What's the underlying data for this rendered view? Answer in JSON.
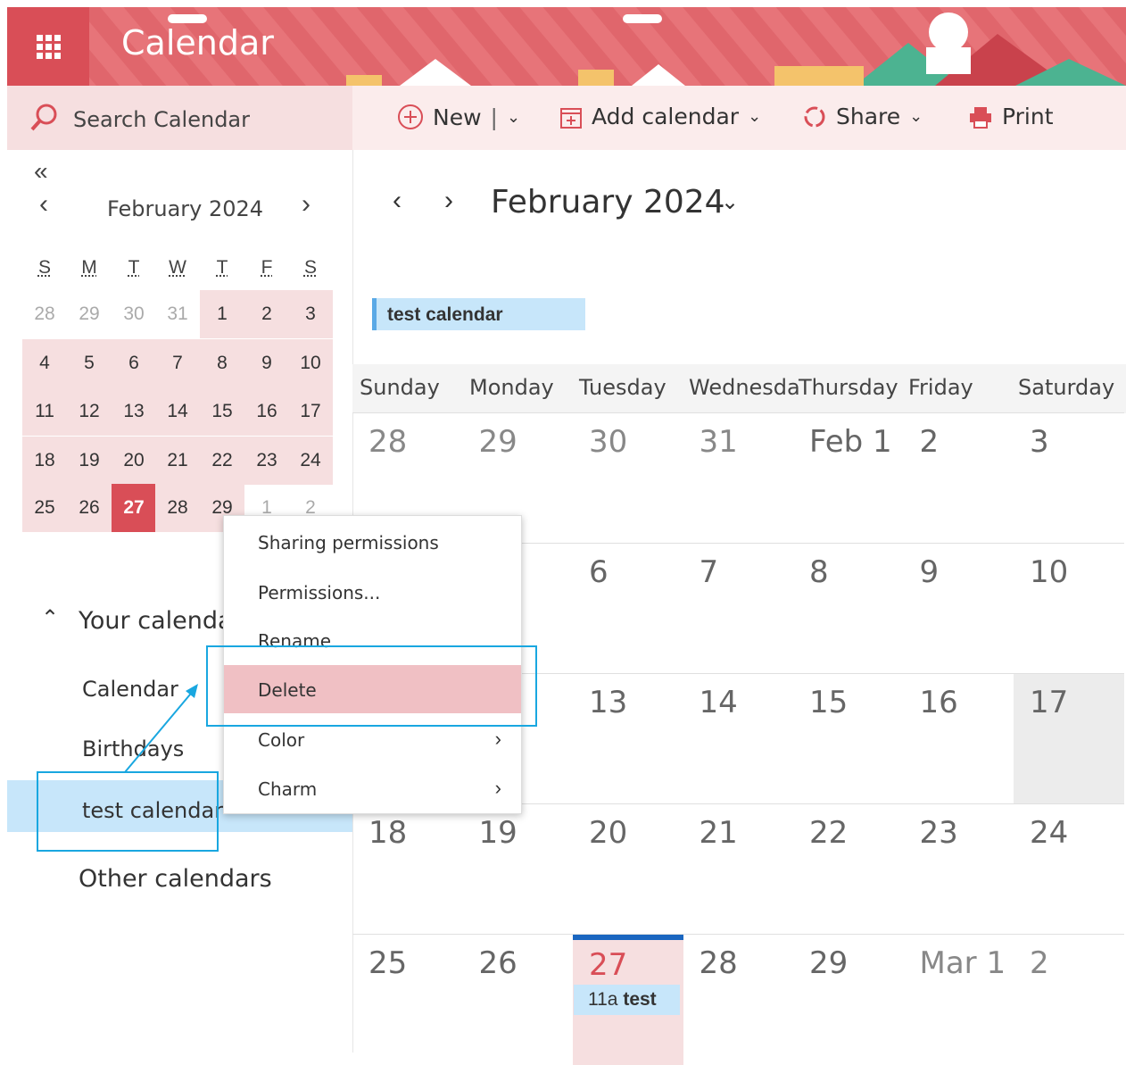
{
  "app": {
    "title": "Calendar"
  },
  "search": {
    "placeholder": "Search Calendar"
  },
  "toolbar": {
    "new_label": "New",
    "new_separator": "|",
    "add_calendar_label": "Add calendar",
    "share_label": "Share",
    "print_label": "Print"
  },
  "mini_calendar": {
    "collapse": "«",
    "prev": "‹",
    "next": "›",
    "month_label": "February 2024",
    "weekdays": [
      "S",
      "M",
      "T",
      "W",
      "T",
      "F",
      "S"
    ],
    "weeks": [
      [
        "28",
        "29",
        "30",
        "31",
        "1",
        "2",
        "3"
      ],
      [
        "4",
        "5",
        "6",
        "7",
        "8",
        "9",
        "10"
      ],
      [
        "11",
        "12",
        "13",
        "14",
        "15",
        "16",
        "17"
      ],
      [
        "18",
        "19",
        "20",
        "21",
        "22",
        "23",
        "24"
      ],
      [
        "25",
        "26",
        "27",
        "28",
        "29",
        "1",
        "2"
      ]
    ]
  },
  "sidebar": {
    "your_calendars_label": "Your calendars",
    "items": [
      {
        "label": "Calendar"
      },
      {
        "label": "Birthdays"
      },
      {
        "label": "test calendar"
      }
    ],
    "other_calendars_label": "Other calendars"
  },
  "main": {
    "prev": "‹",
    "next": "›",
    "month_label": "February 2024",
    "calendar_tag": "test calendar",
    "weekdays": [
      "Sunday",
      "Monday",
      "Tuesday",
      "Wednesda",
      "Thursday",
      "Friday",
      "Saturday"
    ],
    "weeks": [
      [
        "28",
        "29",
        "30",
        "31",
        "Feb 1",
        "2",
        "3"
      ],
      [
        "",
        "",
        "6",
        "7",
        "8",
        "9",
        "10"
      ],
      [
        "",
        "",
        "13",
        "14",
        "15",
        "16",
        "17"
      ],
      [
        "18",
        "19",
        "20",
        "21",
        "22",
        "23",
        "24"
      ],
      [
        "25",
        "26",
        "27",
        "28",
        "29",
        "Mar 1",
        "2"
      ]
    ],
    "event": {
      "time": "11a",
      "title": "test"
    }
  },
  "context_menu": {
    "items": [
      {
        "label": "Sharing permissions"
      },
      {
        "label": "Permissions..."
      },
      {
        "label": "Rename"
      },
      {
        "label": "Delete"
      },
      {
        "label": "Color",
        "arrow": "›"
      },
      {
        "label": "Charm",
        "arrow": "›"
      }
    ]
  },
  "colors": {
    "brand": "#d94e57",
    "header_bg": "#e0666c",
    "highlight": "#f6dfe0",
    "selected": "#c7e6fa",
    "annotation": "#19a7e0"
  }
}
